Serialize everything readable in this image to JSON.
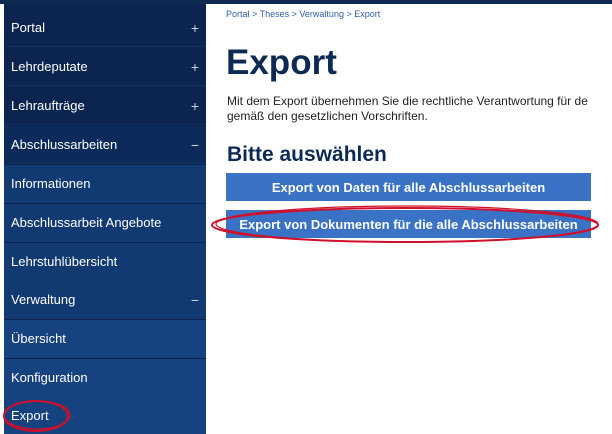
{
  "sidebar": {
    "items": [
      {
        "label": "Portal",
        "toggle": "+"
      },
      {
        "label": "Lehrdeputate",
        "toggle": "+"
      },
      {
        "label": "Lehraufträge",
        "toggle": "+"
      },
      {
        "label": "Abschlussarbeiten",
        "toggle": "−"
      },
      {
        "label": "Informationen"
      },
      {
        "label": "Abschlussarbeit Angebote"
      },
      {
        "label": "Lehrstuhlübersicht"
      },
      {
        "label": "Verwaltung",
        "toggle": "−"
      },
      {
        "label": "Übersicht"
      },
      {
        "label": "Konfiguration"
      },
      {
        "label": "Export"
      }
    ]
  },
  "breadcrumb": {
    "items": [
      "Portal",
      "Theses",
      "Verwaltung",
      "Export"
    ],
    "separator": ">"
  },
  "main": {
    "title": "Export",
    "intro_line1": "Mit dem Export übernehmen Sie die rechtliche Verantwortung für de",
    "intro_line2": "gemäß den gesetzlichen Vorschriften.",
    "section_title": "Bitte auswählen",
    "buttons": [
      {
        "label": "Export von Daten für alle Abschlussarbeiten"
      },
      {
        "label": "Export von Dokumenten für die alle Abschlussarbeiten"
      }
    ]
  },
  "colors": {
    "sidebar_bg": "#0b2550",
    "accent_button": "#3a73c6",
    "title": "#0d2a55",
    "annotation": "#d0102a"
  }
}
